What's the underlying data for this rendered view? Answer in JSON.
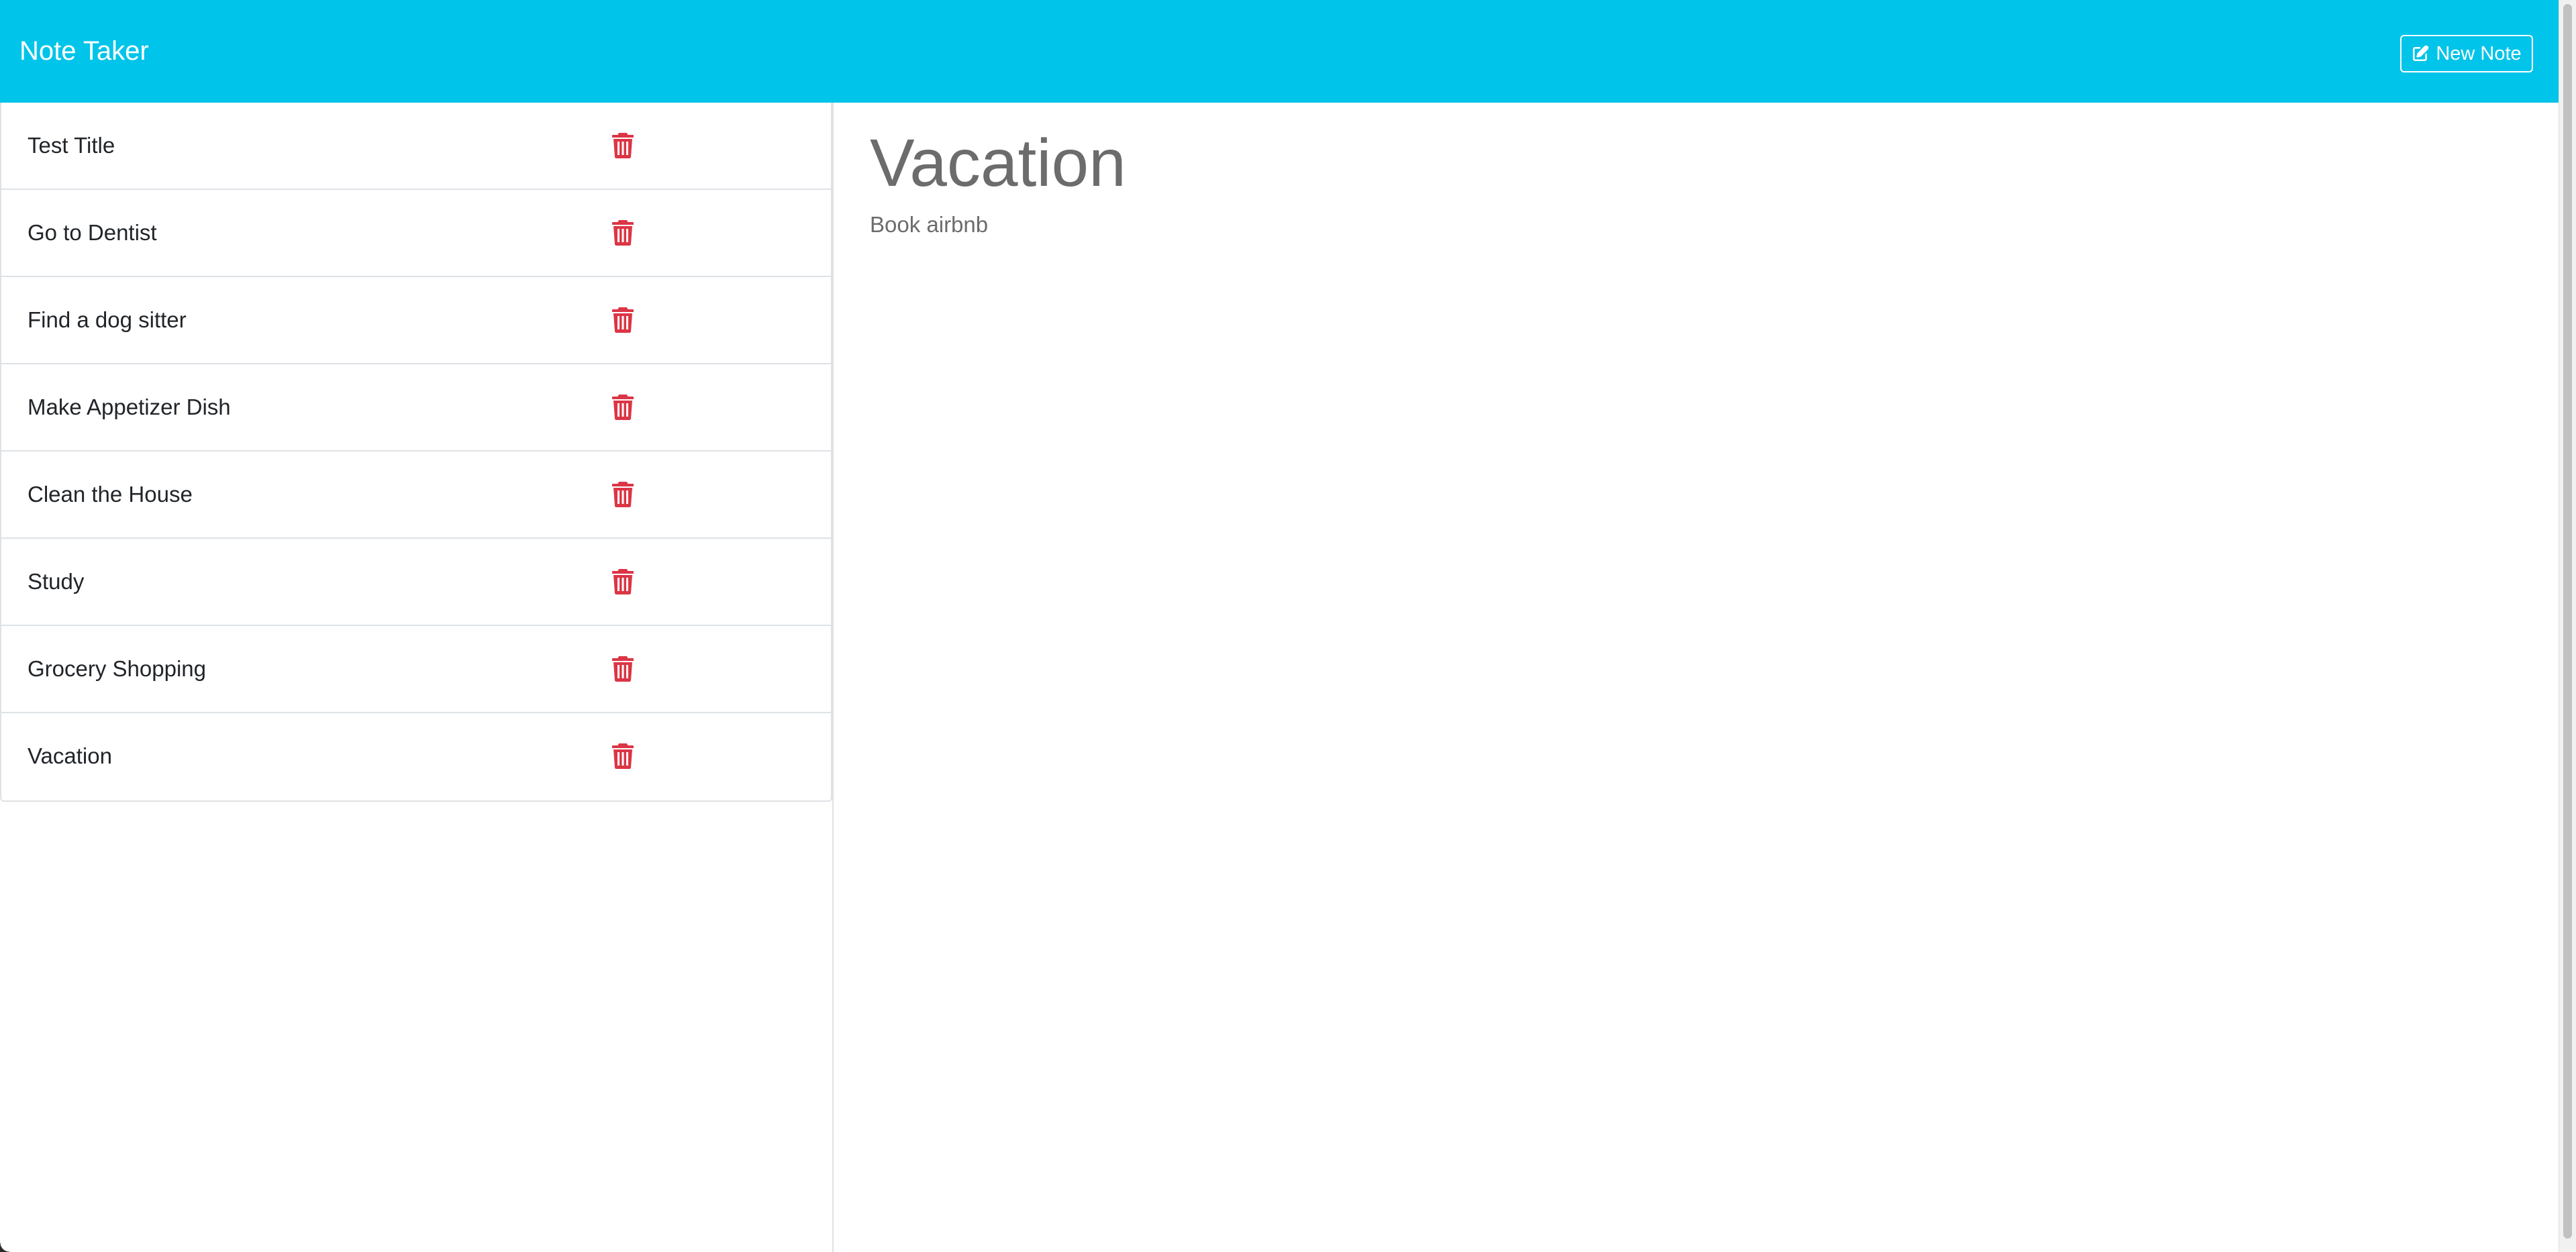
{
  "app": {
    "brand": "Note Taker",
    "new_note_label": "New Note",
    "new_note_icon": "edit-icon"
  },
  "notes": [
    {
      "title": "Test Title"
    },
    {
      "title": "Go to Dentist"
    },
    {
      "title": "Find a dog sitter"
    },
    {
      "title": "Make Appetizer Dish"
    },
    {
      "title": "Clean the House"
    },
    {
      "title": "Study"
    },
    {
      "title": "Grocery Shopping"
    },
    {
      "title": "Vacation"
    }
  ],
  "active_note": {
    "title": "Vacation",
    "text": "Book airbnb"
  },
  "colors": {
    "navbar": "#00c4e9",
    "delete_icon": "#dc3545",
    "note_text": "#6c6c6c"
  },
  "icons": {
    "delete": "trash-icon"
  }
}
